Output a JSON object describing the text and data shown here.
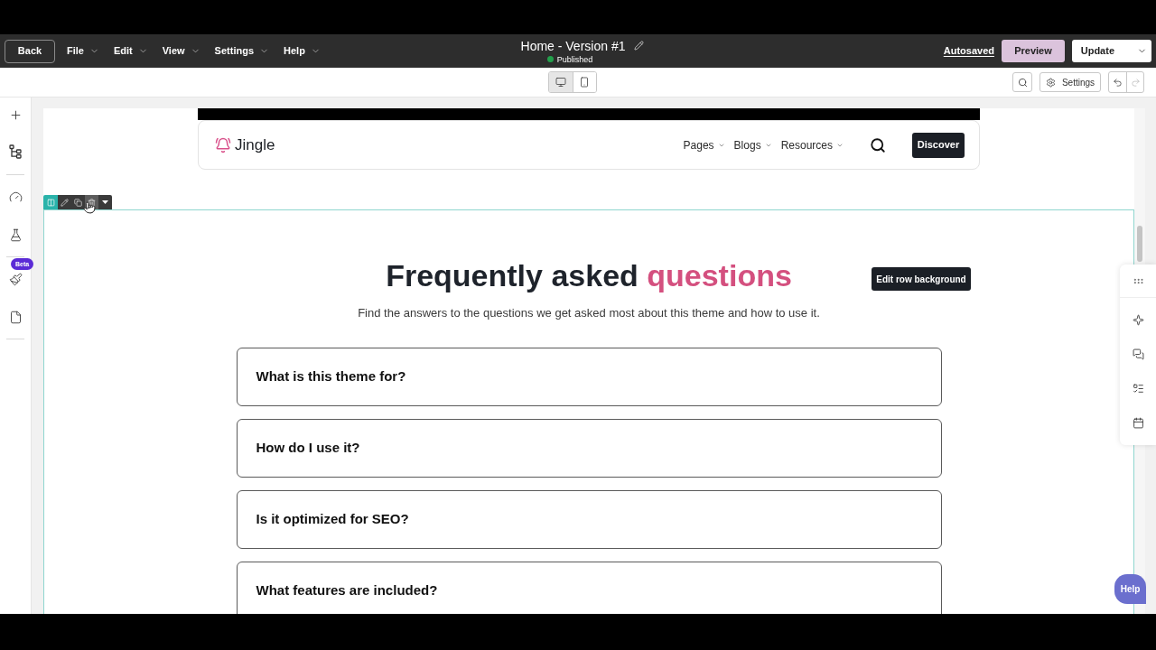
{
  "header": {
    "back": "Back",
    "menus": [
      "File",
      "Edit",
      "View",
      "Settings",
      "Help"
    ],
    "title": "Home - Version #1",
    "status": "Published",
    "autosaved": "Autosaved",
    "preview": "Preview",
    "update": "Update"
  },
  "toolbar": {
    "devices": [
      {
        "kind": "desktop",
        "selected": true
      },
      {
        "kind": "mobile",
        "selected": false
      }
    ],
    "settings": "Settings",
    "history": [
      {
        "kind": "undo",
        "disabled": false
      },
      {
        "kind": "redo",
        "disabled": true
      }
    ]
  },
  "left_rail": {
    "badge": "Beta"
  },
  "site_header": {
    "logo": "Jingle",
    "nav": [
      "Pages",
      "Blogs",
      "Resources"
    ],
    "cta": "Discover"
  },
  "faq": {
    "title_parts": [
      {
        "text": "Frequently asked",
        "highlight": false
      },
      {
        "text": "questions",
        "highlight": true
      }
    ],
    "subtitle": "Find the answers to the questions we get asked most about this theme and how to use it.",
    "questions": [
      "What is this theme for?",
      "How do I use it?",
      "Is it optimized for SEO?",
      "What features are included?"
    ]
  },
  "edit_row_background": "Edit row background",
  "help": "Help"
}
